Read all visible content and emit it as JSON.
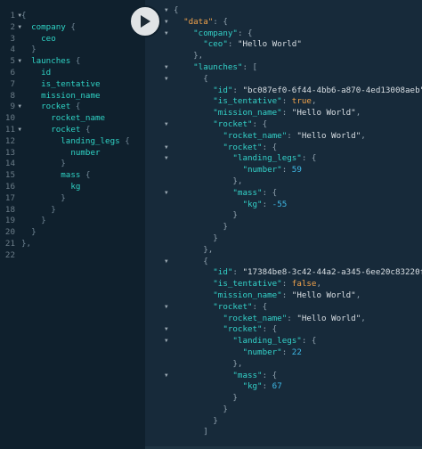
{
  "run_button": {
    "label": "Run query"
  },
  "query": {
    "lines": [
      [
        [
          "p",
          "{"
        ]
      ],
      [
        [
          "i",
          "  "
        ],
        [
          "f",
          "company"
        ],
        [
          "p",
          " {"
        ]
      ],
      [
        [
          "i",
          "    "
        ],
        [
          "f",
          "ceo"
        ]
      ],
      [
        [
          "i",
          "  "
        ],
        [
          "p",
          "}"
        ]
      ],
      [
        [
          "i",
          "  "
        ],
        [
          "f",
          "launches"
        ],
        [
          "p",
          " {"
        ]
      ],
      [
        [
          "i",
          "    "
        ],
        [
          "f",
          "id"
        ]
      ],
      [
        [
          "i",
          "    "
        ],
        [
          "f",
          "is_tentative"
        ]
      ],
      [
        [
          "i",
          "    "
        ],
        [
          "f",
          "mission_name"
        ]
      ],
      [
        [
          "i",
          "    "
        ],
        [
          "f",
          "rocket"
        ],
        [
          "p",
          " {"
        ]
      ],
      [
        [
          "i",
          "      "
        ],
        [
          "f",
          "rocket_name"
        ]
      ],
      [
        [
          "i",
          "      "
        ],
        [
          "f",
          "rocket"
        ],
        [
          "p",
          " {"
        ]
      ],
      [
        [
          "i",
          "        "
        ],
        [
          "f",
          "landing_legs"
        ],
        [
          "p",
          " {"
        ]
      ],
      [
        [
          "i",
          "          "
        ],
        [
          "f",
          "number"
        ]
      ],
      [
        [
          "i",
          "        "
        ],
        [
          "p",
          "}"
        ]
      ],
      [
        [
          "i",
          "        "
        ],
        [
          "f",
          "mass"
        ],
        [
          "p",
          " {"
        ]
      ],
      [
        [
          "i",
          "          "
        ],
        [
          "f",
          "kg"
        ]
      ],
      [
        [
          "i",
          "        "
        ],
        [
          "p",
          "}"
        ]
      ],
      [
        [
          "i",
          "      "
        ],
        [
          "p",
          "}"
        ]
      ],
      [
        [
          "i",
          "    "
        ],
        [
          "p",
          "}"
        ]
      ],
      [
        [
          "i",
          "  "
        ],
        [
          "p",
          "}"
        ]
      ],
      [
        [
          "p",
          "}"
        ],
        [
          "o",
          ","
        ]
      ],
      []
    ],
    "line_numbers": [
      "1",
      "2",
      "3",
      "4",
      "5",
      "6",
      "7",
      "8",
      "9",
      "10",
      "11",
      "12",
      "13",
      "14",
      "15",
      "16",
      "17",
      "18",
      "19",
      "20",
      "21",
      "22"
    ],
    "fold_lines": [
      1,
      2,
      5,
      9,
      11
    ]
  },
  "result": {
    "lines": [
      {
        "fold": true,
        "t": [
          [
            "p",
            "{"
          ]
        ]
      },
      {
        "fold": true,
        "t": [
          [
            "i",
            "  "
          ],
          [
            "d",
            "\"data\""
          ],
          [
            "p",
            ": {"
          ]
        ]
      },
      {
        "fold": true,
        "t": [
          [
            "i",
            "    "
          ],
          [
            "k",
            "\"company\""
          ],
          [
            "p",
            ": {"
          ]
        ]
      },
      {
        "fold": false,
        "t": [
          [
            "i",
            "      "
          ],
          [
            "k",
            "\"ceo\""
          ],
          [
            "p",
            ": "
          ],
          [
            "s",
            "\"Hello World\""
          ]
        ]
      },
      {
        "fold": false,
        "t": [
          [
            "i",
            "    "
          ],
          [
            "p",
            "},"
          ]
        ]
      },
      {
        "fold": true,
        "t": [
          [
            "i",
            "    "
          ],
          [
            "k",
            "\"launches\""
          ],
          [
            "p",
            ": ["
          ]
        ]
      },
      {
        "fold": true,
        "t": [
          [
            "i",
            "      "
          ],
          [
            "p",
            "{"
          ]
        ]
      },
      {
        "fold": false,
        "t": [
          [
            "i",
            "        "
          ],
          [
            "k",
            "\"id\""
          ],
          [
            "p",
            ": "
          ],
          [
            "s",
            "\"bc087ef0-6f44-4bb6-a870-4ed13008aeb\""
          ],
          [
            "p",
            ","
          ]
        ]
      },
      {
        "fold": false,
        "t": [
          [
            "i",
            "        "
          ],
          [
            "k",
            "\"is_tentative\""
          ],
          [
            "p",
            ": "
          ],
          [
            "b",
            "true"
          ],
          [
            "p",
            ","
          ]
        ]
      },
      {
        "fold": false,
        "t": [
          [
            "i",
            "        "
          ],
          [
            "k",
            "\"mission_name\""
          ],
          [
            "p",
            ": "
          ],
          [
            "s",
            "\"Hello World\""
          ],
          [
            "p",
            ","
          ]
        ]
      },
      {
        "fold": true,
        "t": [
          [
            "i",
            "        "
          ],
          [
            "k",
            "\"rocket\""
          ],
          [
            "p",
            ": {"
          ]
        ]
      },
      {
        "fold": false,
        "t": [
          [
            "i",
            "          "
          ],
          [
            "k",
            "\"rocket_name\""
          ],
          [
            "p",
            ": "
          ],
          [
            "s",
            "\"Hello World\""
          ],
          [
            "p",
            ","
          ]
        ]
      },
      {
        "fold": true,
        "t": [
          [
            "i",
            "          "
          ],
          [
            "k",
            "\"rocket\""
          ],
          [
            "p",
            ": {"
          ]
        ]
      },
      {
        "fold": true,
        "t": [
          [
            "i",
            "            "
          ],
          [
            "k",
            "\"landing_legs\""
          ],
          [
            "p",
            ": {"
          ]
        ]
      },
      {
        "fold": false,
        "t": [
          [
            "i",
            "              "
          ],
          [
            "k",
            "\"number\""
          ],
          [
            "p",
            ": "
          ],
          [
            "n",
            "59"
          ]
        ]
      },
      {
        "fold": false,
        "t": [
          [
            "i",
            "            "
          ],
          [
            "p",
            "},"
          ]
        ]
      },
      {
        "fold": true,
        "t": [
          [
            "i",
            "            "
          ],
          [
            "k",
            "\"mass\""
          ],
          [
            "p",
            ": {"
          ]
        ]
      },
      {
        "fold": false,
        "t": [
          [
            "i",
            "              "
          ],
          [
            "k",
            "\"kg\""
          ],
          [
            "p",
            ": "
          ],
          [
            "n",
            "-55"
          ]
        ]
      },
      {
        "fold": false,
        "t": [
          [
            "i",
            "            "
          ],
          [
            "p",
            "}"
          ]
        ]
      },
      {
        "fold": false,
        "t": [
          [
            "i",
            "          "
          ],
          [
            "p",
            "}"
          ]
        ]
      },
      {
        "fold": false,
        "t": [
          [
            "i",
            "        "
          ],
          [
            "p",
            "}"
          ]
        ]
      },
      {
        "fold": false,
        "t": [
          [
            "i",
            "      "
          ],
          [
            "p",
            "},"
          ]
        ]
      },
      {
        "fold": true,
        "t": [
          [
            "i",
            "      "
          ],
          [
            "p",
            "{"
          ]
        ]
      },
      {
        "fold": false,
        "t": [
          [
            "i",
            "        "
          ],
          [
            "k",
            "\"id\""
          ],
          [
            "p",
            ": "
          ],
          [
            "s",
            "\"17384be8-3c42-44a2-a345-6ee20c83220f\""
          ],
          [
            "p",
            ","
          ]
        ]
      },
      {
        "fold": false,
        "t": [
          [
            "i",
            "        "
          ],
          [
            "k",
            "\"is_tentative\""
          ],
          [
            "p",
            ": "
          ],
          [
            "b",
            "false"
          ],
          [
            "p",
            ","
          ]
        ]
      },
      {
        "fold": false,
        "t": [
          [
            "i",
            "        "
          ],
          [
            "k",
            "\"mission_name\""
          ],
          [
            "p",
            ": "
          ],
          [
            "s",
            "\"Hello World\""
          ],
          [
            "p",
            ","
          ]
        ]
      },
      {
        "fold": true,
        "t": [
          [
            "i",
            "        "
          ],
          [
            "k",
            "\"rocket\""
          ],
          [
            "p",
            ": {"
          ]
        ]
      },
      {
        "fold": false,
        "t": [
          [
            "i",
            "          "
          ],
          [
            "k",
            "\"rocket_name\""
          ],
          [
            "p",
            ": "
          ],
          [
            "s",
            "\"Hello World\""
          ],
          [
            "p",
            ","
          ]
        ]
      },
      {
        "fold": true,
        "t": [
          [
            "i",
            "          "
          ],
          [
            "k",
            "\"rocket\""
          ],
          [
            "p",
            ": {"
          ]
        ]
      },
      {
        "fold": true,
        "t": [
          [
            "i",
            "            "
          ],
          [
            "k",
            "\"landing_legs\""
          ],
          [
            "p",
            ": {"
          ]
        ]
      },
      {
        "fold": false,
        "t": [
          [
            "i",
            "              "
          ],
          [
            "k",
            "\"number\""
          ],
          [
            "p",
            ": "
          ],
          [
            "n",
            "22"
          ]
        ]
      },
      {
        "fold": false,
        "t": [
          [
            "i",
            "            "
          ],
          [
            "p",
            "},"
          ]
        ]
      },
      {
        "fold": true,
        "t": [
          [
            "i",
            "            "
          ],
          [
            "k",
            "\"mass\""
          ],
          [
            "p",
            ": {"
          ]
        ]
      },
      {
        "fold": false,
        "t": [
          [
            "i",
            "              "
          ],
          [
            "k",
            "\"kg\""
          ],
          [
            "p",
            ": "
          ],
          [
            "n",
            "67"
          ]
        ]
      },
      {
        "fold": false,
        "t": [
          [
            "i",
            "            "
          ],
          [
            "p",
            "}"
          ]
        ]
      },
      {
        "fold": false,
        "t": [
          [
            "i",
            "          "
          ],
          [
            "p",
            "}"
          ]
        ]
      },
      {
        "fold": false,
        "t": [
          [
            "i",
            "        "
          ],
          [
            "p",
            "}"
          ]
        ]
      },
      {
        "fold": false,
        "t": [
          [
            "i",
            "      "
          ],
          [
            "p",
            "]"
          ]
        ]
      }
    ]
  },
  "colors": {
    "query_bg": "#0f202d",
    "result_bg": "#172a3a",
    "field": "#2fd3c5",
    "key": "#34d2c9",
    "string": "#d9dfe4",
    "number": "#3fb9e6",
    "boolean": "#f0a24b"
  },
  "icons": {
    "run": "play-icon",
    "fold": "fold-caret-icon"
  }
}
